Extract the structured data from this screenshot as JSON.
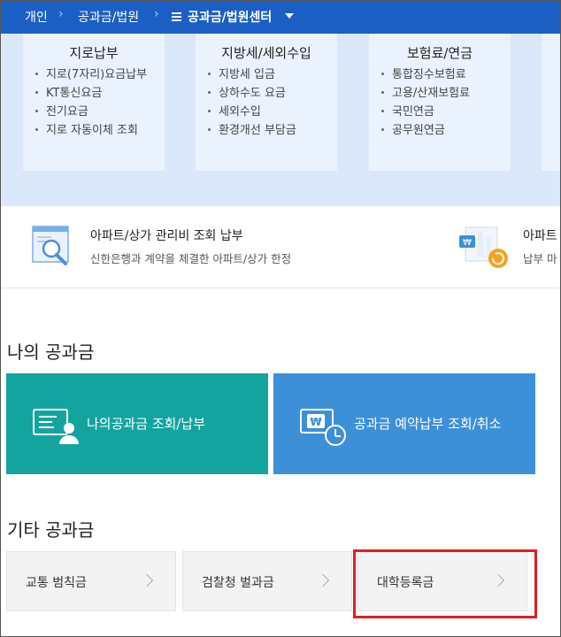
{
  "breadcrumb": {
    "items": [
      "개인",
      "공과금/법원",
      "공과금/법원센터"
    ]
  },
  "categories": [
    {
      "title": "지로납부",
      "items": [
        "지로(7자리)요금납부",
        "KT통신요금",
        "전기요금",
        "지로 자동이체 조회"
      ]
    },
    {
      "title": "지방세/세외수입",
      "items": [
        "지방세 입금",
        "상하수도 요금",
        "세외수입",
        "환경개선 부담금"
      ]
    },
    {
      "title": "보험료/연금",
      "items": [
        "통합징수보험료",
        "고용/산재보험료",
        "국민연금",
        "공무원연금"
      ]
    }
  ],
  "banners": [
    {
      "title": "아파트/상가 관리비 조회 납부",
      "subtitle": "신한은행과 계약을 체결한 아파트/상가 한정"
    },
    {
      "title": "아파트",
      "subtitle": "납부 마"
    }
  ],
  "my_section": {
    "title": "나의 공과금",
    "buttons": [
      {
        "label": "나의공과금 조회/납부",
        "color": "#14a4a0"
      },
      {
        "label": "공과금 예약납부 조회/취소",
        "color": "#3d8fd8"
      }
    ]
  },
  "other_section": {
    "title": "기타 공과금",
    "buttons": [
      {
        "label": "교통 범칙금"
      },
      {
        "label": "검찰청 벌과금"
      },
      {
        "label": "대학등록금"
      }
    ]
  },
  "colors": {
    "topbar": "#1c5fc4",
    "highlight": "#e02020"
  }
}
